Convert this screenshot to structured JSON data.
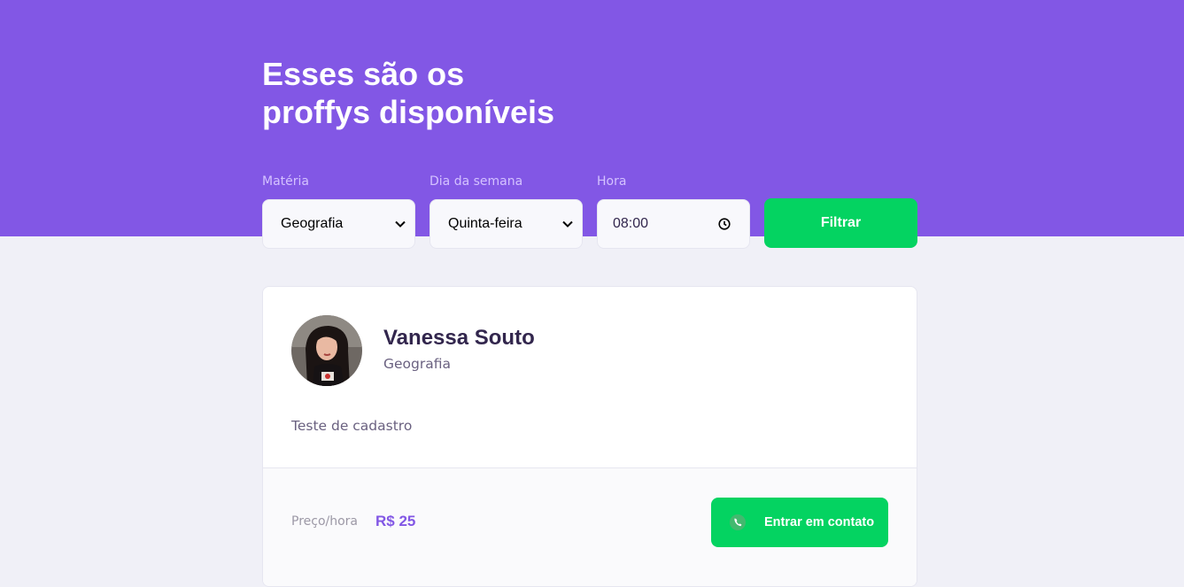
{
  "header": {
    "title_line1": "Esses são os",
    "title_line2": "proffys disponíveis"
  },
  "filters": {
    "subject_label": "Matéria",
    "subject_value": "Geografia",
    "weekday_label": "Dia da semana",
    "weekday_value": "Quinta-feira",
    "time_label": "Hora",
    "time_value": "08:00",
    "submit_label": "Filtrar"
  },
  "teachers": [
    {
      "name": "Vanessa Souto",
      "subject": "Geografia",
      "bio": "Teste de cadastro",
      "price_label": "Preço/hora",
      "price_value": "R$ 25",
      "contact_label": "Entrar em contato"
    }
  ],
  "colors": {
    "primary": "#8257E5",
    "secondary": "#04D361",
    "background": "#F0F0F7",
    "title_in_primary": "#FFFFFF",
    "label_in_primary": "#D4C2FF",
    "text_title": "#32264D",
    "text_base": "#6A6180"
  },
  "icons": {
    "select_chevron": "chevron-down-icon",
    "time": "clock-icon",
    "contact": "whatsapp-icon"
  }
}
